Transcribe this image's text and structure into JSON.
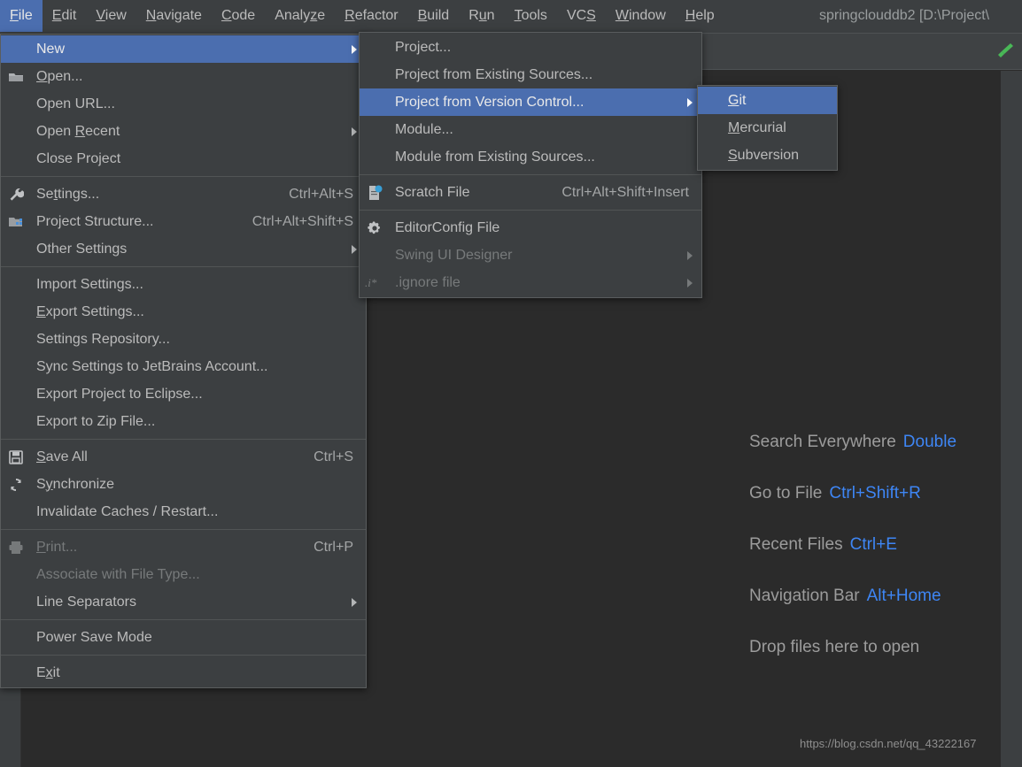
{
  "window": {
    "title": "springclouddb2 [D:\\Project\\"
  },
  "menubar": {
    "items": [
      {
        "label": "File",
        "mnemonic": "F",
        "active": true
      },
      {
        "label": "Edit",
        "mnemonic": "E",
        "active": false
      },
      {
        "label": "View",
        "mnemonic": "V",
        "active": false
      },
      {
        "label": "Navigate",
        "mnemonic": "N",
        "active": false
      },
      {
        "label": "Code",
        "mnemonic": "C",
        "active": false
      },
      {
        "label": "Analyze",
        "mnemonic": "z",
        "active": false
      },
      {
        "label": "Refactor",
        "mnemonic": "R",
        "active": false
      },
      {
        "label": "Build",
        "mnemonic": "B",
        "active": false
      },
      {
        "label": "Run",
        "mnemonic": "u",
        "active": false
      },
      {
        "label": "Tools",
        "mnemonic": "T",
        "active": false
      },
      {
        "label": "VCS",
        "mnemonic": "S",
        "active": false
      },
      {
        "label": "Window",
        "mnemonic": "W",
        "active": false
      },
      {
        "label": "Help",
        "mnemonic": "H",
        "active": false
      }
    ]
  },
  "file_menu": {
    "items": [
      {
        "type": "item",
        "label": "New",
        "icon": "",
        "shortcut": "",
        "submenu": true,
        "selected": true,
        "disabled": false
      },
      {
        "type": "item",
        "label": "Open...",
        "mnemonic": "O",
        "icon": "folder-icon",
        "shortcut": "",
        "submenu": false,
        "selected": false,
        "disabled": false
      },
      {
        "type": "item",
        "label": "Open URL...",
        "icon": "",
        "shortcut": "",
        "submenu": false,
        "selected": false,
        "disabled": false
      },
      {
        "type": "item",
        "label": "Open Recent",
        "mnemonic": "R",
        "icon": "",
        "shortcut": "",
        "submenu": true,
        "selected": false,
        "disabled": false
      },
      {
        "type": "item",
        "label": "Close Project",
        "icon": "",
        "shortcut": "",
        "submenu": false,
        "selected": false,
        "disabled": false
      },
      {
        "type": "separator"
      },
      {
        "type": "item",
        "label": "Settings...",
        "mnemonic": "t",
        "icon": "wrench-icon",
        "shortcut": "Ctrl+Alt+S",
        "submenu": false,
        "selected": false,
        "disabled": false
      },
      {
        "type": "item",
        "label": "Project Structure...",
        "icon": "project-structure-icon",
        "shortcut": "Ctrl+Alt+Shift+S",
        "submenu": false,
        "selected": false,
        "disabled": false
      },
      {
        "type": "item",
        "label": "Other Settings",
        "icon": "",
        "shortcut": "",
        "submenu": true,
        "selected": false,
        "disabled": false
      },
      {
        "type": "separator"
      },
      {
        "type": "item",
        "label": "Import Settings...",
        "icon": "",
        "shortcut": "",
        "submenu": false,
        "selected": false,
        "disabled": false
      },
      {
        "type": "item",
        "label": "Export Settings...",
        "mnemonic": "E",
        "icon": "",
        "shortcut": "",
        "submenu": false,
        "selected": false,
        "disabled": false
      },
      {
        "type": "item",
        "label": "Settings Repository...",
        "icon": "",
        "shortcut": "",
        "submenu": false,
        "selected": false,
        "disabled": false
      },
      {
        "type": "item",
        "label": "Sync Settings to JetBrains Account...",
        "icon": "",
        "shortcut": "",
        "submenu": false,
        "selected": false,
        "disabled": false
      },
      {
        "type": "item",
        "label": "Export Project to Eclipse...",
        "icon": "",
        "shortcut": "",
        "submenu": false,
        "selected": false,
        "disabled": false
      },
      {
        "type": "item",
        "label": "Export to Zip File...",
        "icon": "",
        "shortcut": "",
        "submenu": false,
        "selected": false,
        "disabled": false
      },
      {
        "type": "separator"
      },
      {
        "type": "item",
        "label": "Save All",
        "mnemonic": "S",
        "icon": "save-icon",
        "shortcut": "Ctrl+S",
        "submenu": false,
        "selected": false,
        "disabled": false
      },
      {
        "type": "item",
        "label": "Synchronize",
        "mnemonic": "y",
        "icon": "synchronize-icon",
        "shortcut": "",
        "submenu": false,
        "selected": false,
        "disabled": false
      },
      {
        "type": "item",
        "label": "Invalidate Caches / Restart...",
        "icon": "",
        "shortcut": "",
        "submenu": false,
        "selected": false,
        "disabled": false
      },
      {
        "type": "separator"
      },
      {
        "type": "item",
        "label": "Print...",
        "mnemonic": "P",
        "icon": "printer-icon",
        "shortcut": "Ctrl+P",
        "submenu": false,
        "selected": false,
        "disabled": true
      },
      {
        "type": "item",
        "label": "Associate with File Type...",
        "icon": "",
        "shortcut": "",
        "submenu": false,
        "selected": false,
        "disabled": true
      },
      {
        "type": "item",
        "label": "Line Separators",
        "icon": "",
        "shortcut": "",
        "submenu": true,
        "selected": false,
        "disabled": false
      },
      {
        "type": "separator"
      },
      {
        "type": "item",
        "label": "Power Save Mode",
        "icon": "",
        "shortcut": "",
        "submenu": false,
        "selected": false,
        "disabled": false
      },
      {
        "type": "separator"
      },
      {
        "type": "item",
        "label": "Exit",
        "mnemonic": "x",
        "icon": "",
        "shortcut": "",
        "submenu": false,
        "selected": false,
        "disabled": false
      }
    ]
  },
  "new_menu": {
    "items": [
      {
        "type": "item",
        "label": "Project...",
        "icon": "",
        "shortcut": "",
        "submenu": false,
        "selected": false,
        "disabled": false
      },
      {
        "type": "item",
        "label": "Project from Existing Sources...",
        "icon": "",
        "shortcut": "",
        "submenu": false,
        "selected": false,
        "disabled": false
      },
      {
        "type": "item",
        "label": "Project from Version Control...",
        "icon": "",
        "shortcut": "",
        "submenu": true,
        "selected": true,
        "disabled": false
      },
      {
        "type": "item",
        "label": "Module...",
        "icon": "",
        "shortcut": "",
        "submenu": false,
        "selected": false,
        "disabled": false
      },
      {
        "type": "item",
        "label": "Module from Existing Sources...",
        "icon": "",
        "shortcut": "",
        "submenu": false,
        "selected": false,
        "disabled": false
      },
      {
        "type": "separator"
      },
      {
        "type": "item",
        "label": "Scratch File",
        "icon": "scratch-file-icon",
        "shortcut": "Ctrl+Alt+Shift+Insert",
        "submenu": false,
        "selected": false,
        "disabled": false
      },
      {
        "type": "separator"
      },
      {
        "type": "item",
        "label": "EditorConfig File",
        "icon": "gear-icon",
        "shortcut": "",
        "submenu": false,
        "selected": false,
        "disabled": false
      },
      {
        "type": "item",
        "label": "Swing UI Designer",
        "icon": "",
        "shortcut": "",
        "submenu": true,
        "selected": false,
        "disabled": true
      },
      {
        "type": "item",
        "label": ".ignore file",
        "icon": "ignore-file-icon",
        "shortcut": "",
        "submenu": true,
        "selected": false,
        "disabled": true
      }
    ]
  },
  "vcs_menu": {
    "items": [
      {
        "type": "item",
        "label": "Git",
        "mnemonic": "G",
        "icon": "",
        "shortcut": "",
        "submenu": false,
        "selected": true,
        "disabled": false
      },
      {
        "type": "item",
        "label": "Mercurial",
        "mnemonic": "M",
        "icon": "",
        "shortcut": "",
        "submenu": false,
        "selected": false,
        "disabled": false
      },
      {
        "type": "item",
        "label": "Subversion",
        "mnemonic": "S",
        "icon": "",
        "shortcut": "",
        "submenu": false,
        "selected": false,
        "disabled": false
      }
    ]
  },
  "editor_hints": [
    {
      "label": "Search Everywhere",
      "key": "Double"
    },
    {
      "label": "Go to File",
      "key": "Ctrl+Shift+R"
    },
    {
      "label": "Recent Files",
      "key": "Ctrl+E"
    },
    {
      "label": "Navigation Bar",
      "key": "Alt+Home"
    },
    {
      "label": "Drop files here to open",
      "key": ""
    }
  ],
  "watermark": "https://blog.csdn.net/qq_43222167",
  "colors": {
    "menu_bg": "#3c3f41",
    "editor_bg": "#2b2b2b",
    "selection": "#4b6eaf",
    "text": "#bbbbbb",
    "disabled_text": "#777a7b",
    "hint_key": "#3e86f5",
    "build_icon": "#49b857"
  }
}
